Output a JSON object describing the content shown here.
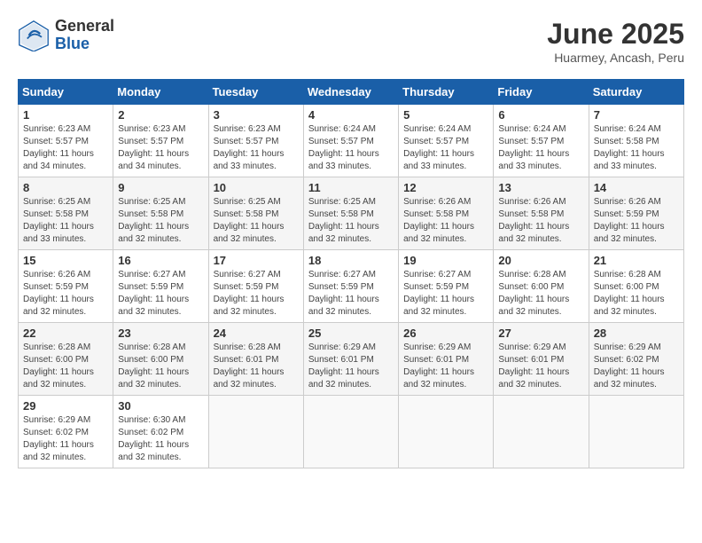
{
  "header": {
    "logo_general": "General",
    "logo_blue": "Blue",
    "month_title": "June 2025",
    "location": "Huarmey, Ancash, Peru"
  },
  "calendar": {
    "days_of_week": [
      "Sunday",
      "Monday",
      "Tuesday",
      "Wednesday",
      "Thursday",
      "Friday",
      "Saturday"
    ],
    "weeks": [
      [
        {
          "day": "1",
          "sunrise": "6:23 AM",
          "sunset": "5:57 PM",
          "daylight": "11 hours and 34 minutes."
        },
        {
          "day": "2",
          "sunrise": "6:23 AM",
          "sunset": "5:57 PM",
          "daylight": "11 hours and 34 minutes."
        },
        {
          "day": "3",
          "sunrise": "6:23 AM",
          "sunset": "5:57 PM",
          "daylight": "11 hours and 33 minutes."
        },
        {
          "day": "4",
          "sunrise": "6:24 AM",
          "sunset": "5:57 PM",
          "daylight": "11 hours and 33 minutes."
        },
        {
          "day": "5",
          "sunrise": "6:24 AM",
          "sunset": "5:57 PM",
          "daylight": "11 hours and 33 minutes."
        },
        {
          "day": "6",
          "sunrise": "6:24 AM",
          "sunset": "5:57 PM",
          "daylight": "11 hours and 33 minutes."
        },
        {
          "day": "7",
          "sunrise": "6:24 AM",
          "sunset": "5:58 PM",
          "daylight": "11 hours and 33 minutes."
        }
      ],
      [
        {
          "day": "8",
          "sunrise": "6:25 AM",
          "sunset": "5:58 PM",
          "daylight": "11 hours and 33 minutes."
        },
        {
          "day": "9",
          "sunrise": "6:25 AM",
          "sunset": "5:58 PM",
          "daylight": "11 hours and 32 minutes."
        },
        {
          "day": "10",
          "sunrise": "6:25 AM",
          "sunset": "5:58 PM",
          "daylight": "11 hours and 32 minutes."
        },
        {
          "day": "11",
          "sunrise": "6:25 AM",
          "sunset": "5:58 PM",
          "daylight": "11 hours and 32 minutes."
        },
        {
          "day": "12",
          "sunrise": "6:26 AM",
          "sunset": "5:58 PM",
          "daylight": "11 hours and 32 minutes."
        },
        {
          "day": "13",
          "sunrise": "6:26 AM",
          "sunset": "5:58 PM",
          "daylight": "11 hours and 32 minutes."
        },
        {
          "day": "14",
          "sunrise": "6:26 AM",
          "sunset": "5:59 PM",
          "daylight": "11 hours and 32 minutes."
        }
      ],
      [
        {
          "day": "15",
          "sunrise": "6:26 AM",
          "sunset": "5:59 PM",
          "daylight": "11 hours and 32 minutes."
        },
        {
          "day": "16",
          "sunrise": "6:27 AM",
          "sunset": "5:59 PM",
          "daylight": "11 hours and 32 minutes."
        },
        {
          "day": "17",
          "sunrise": "6:27 AM",
          "sunset": "5:59 PM",
          "daylight": "11 hours and 32 minutes."
        },
        {
          "day": "18",
          "sunrise": "6:27 AM",
          "sunset": "5:59 PM",
          "daylight": "11 hours and 32 minutes."
        },
        {
          "day": "19",
          "sunrise": "6:27 AM",
          "sunset": "5:59 PM",
          "daylight": "11 hours and 32 minutes."
        },
        {
          "day": "20",
          "sunrise": "6:28 AM",
          "sunset": "6:00 PM",
          "daylight": "11 hours and 32 minutes."
        },
        {
          "day": "21",
          "sunrise": "6:28 AM",
          "sunset": "6:00 PM",
          "daylight": "11 hours and 32 minutes."
        }
      ],
      [
        {
          "day": "22",
          "sunrise": "6:28 AM",
          "sunset": "6:00 PM",
          "daylight": "11 hours and 32 minutes."
        },
        {
          "day": "23",
          "sunrise": "6:28 AM",
          "sunset": "6:00 PM",
          "daylight": "11 hours and 32 minutes."
        },
        {
          "day": "24",
          "sunrise": "6:28 AM",
          "sunset": "6:01 PM",
          "daylight": "11 hours and 32 minutes."
        },
        {
          "day": "25",
          "sunrise": "6:29 AM",
          "sunset": "6:01 PM",
          "daylight": "11 hours and 32 minutes."
        },
        {
          "day": "26",
          "sunrise": "6:29 AM",
          "sunset": "6:01 PM",
          "daylight": "11 hours and 32 minutes."
        },
        {
          "day": "27",
          "sunrise": "6:29 AM",
          "sunset": "6:01 PM",
          "daylight": "11 hours and 32 minutes."
        },
        {
          "day": "28",
          "sunrise": "6:29 AM",
          "sunset": "6:02 PM",
          "daylight": "11 hours and 32 minutes."
        }
      ],
      [
        {
          "day": "29",
          "sunrise": "6:29 AM",
          "sunset": "6:02 PM",
          "daylight": "11 hours and 32 minutes."
        },
        {
          "day": "30",
          "sunrise": "6:30 AM",
          "sunset": "6:02 PM",
          "daylight": "11 hours and 32 minutes."
        },
        {
          "day": "",
          "sunrise": "",
          "sunset": "",
          "daylight": ""
        },
        {
          "day": "",
          "sunrise": "",
          "sunset": "",
          "daylight": ""
        },
        {
          "day": "",
          "sunrise": "",
          "sunset": "",
          "daylight": ""
        },
        {
          "day": "",
          "sunrise": "",
          "sunset": "",
          "daylight": ""
        },
        {
          "day": "",
          "sunrise": "",
          "sunset": "",
          "daylight": ""
        }
      ]
    ]
  }
}
